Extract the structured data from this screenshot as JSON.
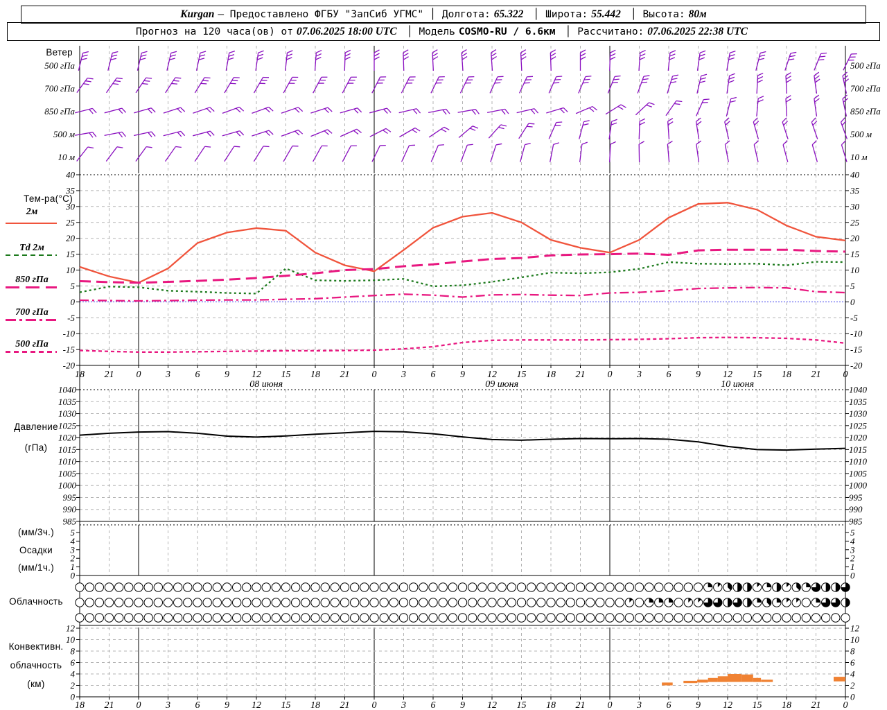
{
  "header": {
    "station": "Kurgan",
    "provided_by": "— Предоставлено ФГБУ \"ЗапСиб УГМС\"",
    "sep": "│",
    "lon_label": "Долгота:",
    "lon": "65.322",
    "lat_label": "Широта:",
    "lat": "55.442",
    "alt_label": "Высота:",
    "alt": "80м",
    "line2_prefix": "Прогноз на 120 часа(ов) от",
    "forecast_start": "07.06.2025 18:00 UTC",
    "model_label": "Модель",
    "model": "COSMO-RU / 6.6км",
    "calc_label": "Рассчитано:",
    "calc_time": "07.06.2025 22:38 UTC"
  },
  "panels": {
    "wind": {
      "title": "Ветер"
    },
    "temp": {
      "title": "Тем-ра(°C)",
      "legend": [
        {
          "label": "2м"
        },
        {
          "label": "Td  2м"
        },
        {
          "label": "850 гПа"
        },
        {
          "label": "700 гПа"
        },
        {
          "label": "500 гПа"
        }
      ]
    },
    "pressure": {
      "title1": "Давление",
      "title2": "(гПа)"
    },
    "precip": {
      "title1": "(мм/3ч.)",
      "title2": "Осадки",
      "title3": "(мм/1ч.)"
    },
    "cloud": {
      "title": "Облачность"
    },
    "conv": {
      "title1": "Конвективн.",
      "title2": "облачность",
      "title3": "(км)"
    }
  },
  "axis": {
    "hour_labels": [
      "18",
      "21",
      "0",
      "3",
      "6",
      "9",
      "12",
      "15",
      "18",
      "21",
      "0",
      "3",
      "6",
      "9",
      "12",
      "15",
      "18",
      "21",
      "0",
      "3",
      "6",
      "9",
      "12",
      "15",
      "18",
      "21",
      "0"
    ],
    "date_labels": [
      {
        "label": "08 июня",
        "center_hour": 19
      },
      {
        "label": "09 июня",
        "center_hour": 43
      },
      {
        "label": "10 июня",
        "center_hour": 67
      }
    ],
    "temp_ticks": [
      40,
      35,
      30,
      25,
      20,
      15,
      10,
      5,
      0,
      -5,
      -10,
      -15,
      -20
    ],
    "pressure_ticks": [
      1040,
      1035,
      1030,
      1025,
      1020,
      1015,
      1010,
      1005,
      1000,
      995,
      990,
      985
    ],
    "precip_ticks": [
      5,
      4,
      3,
      2,
      1,
      0
    ],
    "conv_ticks": [
      12,
      10,
      8,
      6,
      4,
      2,
      0
    ]
  },
  "colors": {
    "t2m": "#f0543c",
    "td2m": "#1d7a1d",
    "pink": "#e81880",
    "wind": "#8a10c0",
    "pressure": "#000000",
    "convective": "#f08233",
    "grid": "#b3b3b3",
    "zero_line": "#4444ee"
  },
  "chart_data": [
    {
      "id": "temperature",
      "type": "line",
      "title": "Тем-ра(°C)",
      "ylim": [
        -20,
        40
      ],
      "x_step_hours": 3,
      "series": [
        {
          "name": "2м",
          "color": "#f0543c",
          "style": "solid",
          "values": [
            11,
            8,
            6,
            10.5,
            18.5,
            21.8,
            23.2,
            22.4,
            15.5,
            11.5,
            9.6,
            16.3,
            23.3,
            26.8,
            28,
            25,
            19.5,
            17,
            15.5,
            19.5,
            26.5,
            30.8,
            31.2,
            29,
            24,
            20.5,
            19.3
          ]
        },
        {
          "name": "Td 2м",
          "color": "#1d7a1d",
          "style": "dotted",
          "values": [
            3,
            4.8,
            4.6,
            3.5,
            3.2,
            2.8,
            2.6,
            10.5,
            6.8,
            6.6,
            6.8,
            7.2,
            4.9,
            5.2,
            6.3,
            7.7,
            9.2,
            9,
            9.3,
            10.4,
            12.5,
            12,
            11.9,
            12,
            11.5,
            12.6,
            12.5
          ]
        },
        {
          "name": "850 гПа",
          "color": "#e81880",
          "style": "longdash",
          "values": [
            6.5,
            6.2,
            6,
            6.3,
            6.6,
            7,
            7.5,
            8.2,
            9,
            10,
            10.3,
            11.2,
            11.8,
            12.7,
            13.5,
            13.8,
            14.6,
            14.9,
            15,
            15.2,
            14.8,
            16.2,
            16.4,
            16.4,
            16.4,
            16,
            15.8
          ]
        },
        {
          "name": "700 гПа",
          "color": "#e81880",
          "style": "dashdot",
          "values": [
            0.5,
            0.4,
            0.3,
            0.4,
            0.5,
            0.6,
            0.6,
            0.8,
            1,
            1.5,
            2,
            2.4,
            2.1,
            1.5,
            2.2,
            2.3,
            2.1,
            2,
            2.8,
            3,
            3.5,
            4.2,
            4.4,
            4.5,
            4.4,
            3.2,
            2.9
          ]
        },
        {
          "name": "500 гПа",
          "color": "#e81880",
          "style": "shortdash",
          "values": [
            -15.3,
            -15.6,
            -15.8,
            -15.8,
            -15.7,
            -15.6,
            -15.5,
            -15.4,
            -15.4,
            -15.3,
            -15.2,
            -14.8,
            -14.1,
            -12.8,
            -12.1,
            -12,
            -12,
            -12,
            -11.9,
            -11.8,
            -11.6,
            -11.3,
            -11.2,
            -11.3,
            -11.5,
            -12,
            -13
          ]
        }
      ]
    },
    {
      "id": "pressure",
      "type": "line",
      "ylabel": "Давление (гПа)",
      "ylim": [
        985,
        1040
      ],
      "values": [
        1021,
        1021.8,
        1022.3,
        1022.5,
        1021.8,
        1020.6,
        1020.2,
        1020.7,
        1021.4,
        1022,
        1022.6,
        1022.4,
        1021.6,
        1020.3,
        1019.2,
        1018.9,
        1019.3,
        1019.6,
        1019.5,
        1019.6,
        1019.3,
        1018.2,
        1016.3,
        1015,
        1014.8,
        1015.2,
        1015.5
      ]
    },
    {
      "id": "precipitation",
      "type": "bar",
      "ylabel": "Осадки (мм/3ч., мм/1ч.)",
      "ylim": [
        0,
        5
      ],
      "values": [
        0,
        0,
        0,
        0,
        0,
        0,
        0,
        0,
        0,
        0,
        0,
        0,
        0,
        0,
        0,
        0,
        0,
        0,
        0,
        0,
        0,
        0,
        0,
        0,
        0,
        0,
        0
      ]
    },
    {
      "id": "cloudiness",
      "type": "symbols",
      "note": "hourly cloud-cover circles in eighths (0=clear, 8=overcast)",
      "rows": [
        {
          "oktas": "0000000000000000000000000000000000000000000000000000000000000000213441241326446"
        },
        {
          "oktas": "0000000000000000000000000000000000000000000000000000000010222011664642321102664"
        },
        {
          "oktas": "0000000000000000000000000000000000000000000000000000000000000000000000000000000"
        }
      ]
    },
    {
      "id": "convective_clouds",
      "type": "bar",
      "ylabel": "Конвективн. облачность (км)",
      "ylim": [
        0,
        12
      ],
      "color": "#f08233",
      "segments": [
        {
          "h0": 59.3,
          "h1": 60.4,
          "base_km": 2.0,
          "top_km": 2.5
        },
        {
          "h0": 61.5,
          "h1": 62.9,
          "base_km": 2.4,
          "top_km": 2.8
        },
        {
          "h0": 62.9,
          "h1": 64.0,
          "base_km": 2.5,
          "top_km": 3.0
        },
        {
          "h0": 64.0,
          "h1": 65.0,
          "base_km": 2.6,
          "top_km": 3.3
        },
        {
          "h0": 65.0,
          "h1": 66.0,
          "base_km": 2.6,
          "top_km": 3.6
        },
        {
          "h0": 66.0,
          "h1": 67.4,
          "base_km": 2.6,
          "top_km": 4.0
        },
        {
          "h0": 67.4,
          "h1": 68.6,
          "base_km": 2.6,
          "top_km": 3.9
        },
        {
          "h0": 68.6,
          "h1": 69.4,
          "base_km": 2.6,
          "top_km": 3.3
        },
        {
          "h0": 69.4,
          "h1": 70.6,
          "base_km": 2.6,
          "top_km": 3.0
        },
        {
          "h0": 76.8,
          "h1": 78.0,
          "base_km": 2.7,
          "top_km": 3.5
        }
      ]
    },
    {
      "id": "wind_barbs",
      "type": "barbs",
      "color": "#8a10c0",
      "levels": [
        {
          "label": "500 гПа",
          "feathers": 3,
          "angles": [
            14,
            14,
            13,
            13,
            12,
            10,
            8,
            6,
            4,
            2,
            0,
            -2,
            -3,
            -4,
            -4,
            -3,
            -2,
            0,
            2,
            4,
            6,
            8,
            10,
            14,
            18,
            22,
            26
          ]
        },
        {
          "label": "700 гПа",
          "feathers": 3,
          "angles": [
            36,
            35,
            34,
            33,
            32,
            31,
            30,
            29,
            28,
            28,
            27,
            27,
            26,
            26,
            25,
            25,
            24,
            23,
            22,
            20,
            17,
            13,
            8,
            3,
            -3,
            -8,
            -12
          ]
        },
        {
          "label": "850 гПа",
          "feathers": 2,
          "angles": [
            76,
            75,
            74,
            72,
            71,
            70,
            70,
            71,
            72,
            74,
            75,
            77,
            79,
            80,
            79,
            77,
            73,
            67,
            58,
            47,
            35,
            24,
            14,
            5,
            -3,
            -8,
            -12
          ]
        },
        {
          "label": "500 м",
          "feathers": 2,
          "angles": [
            80,
            79,
            78,
            76,
            75,
            74,
            72,
            70,
            68,
            66,
            63,
            60,
            56,
            50,
            42,
            33,
            24,
            15,
            8,
            2,
            -4,
            -9,
            -13,
            -16,
            -18,
            -19,
            -20
          ]
        },
        {
          "label": "10 м",
          "feathers": 1,
          "angles": [
            38,
            37,
            36,
            35,
            34,
            33,
            32,
            30,
            29,
            28,
            26,
            25,
            23,
            21,
            18,
            15,
            11,
            7,
            3,
            -1,
            -5,
            -8,
            -11,
            -13,
            -15,
            -16,
            -17
          ]
        }
      ]
    }
  ]
}
